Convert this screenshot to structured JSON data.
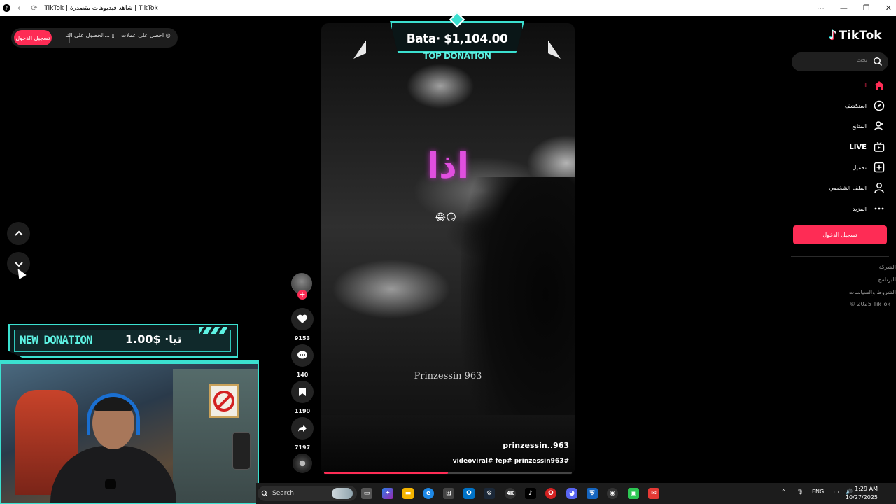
{
  "browser": {
    "title": "TikTok | شاهد فيديوهات متصدرة | TikTok",
    "minimize": "—",
    "restore": "❐",
    "close": "✕",
    "menu": "⋯"
  },
  "top_actions": {
    "login": "تسجيل الدخول",
    "get_app": "الحصول على التـ...",
    "get_coins": "احصل على عملات"
  },
  "overlay": {
    "top_donation_value": "Bata· $1,104.00",
    "top_donation_label": "TOP DONATION",
    "new_donation_label": "NEW DONATION",
    "new_donation_amount": "تيا· $1.00"
  },
  "video": {
    "text": "اذا",
    "emoji": "😂😏",
    "watermark": "Prinzessin 963",
    "author": "prinzessin..963",
    "caption": "videoviral# fep# prinzessin963#",
    "progress": 0.5
  },
  "actions": {
    "likes": "9153",
    "comments": "140",
    "saves": "1190",
    "shares": "7197"
  },
  "sidebar": {
    "logo": "TikTok",
    "search_placeholder": "بحث",
    "items": [
      {
        "label": "الـ",
        "icon": "home-icon",
        "active": true
      },
      {
        "label": "استكشف",
        "icon": "compass-icon"
      },
      {
        "label": "المتابَع",
        "icon": "following-icon"
      },
      {
        "label": "LIVE",
        "icon": "live-icon"
      },
      {
        "label": "تحميل",
        "icon": "upload-icon"
      },
      {
        "label": "الملف الشخصي",
        "icon": "profile-icon"
      },
      {
        "label": "المزيد",
        "icon": "more-icon"
      }
    ],
    "login_button": "تسجيل الدخول",
    "footer": [
      "الشركة",
      "البرنامج",
      "الشروط والسياسات",
      "© 2025 TikTok"
    ]
  },
  "taskbar": {
    "search_label": "Search",
    "lang": "ENG",
    "time": "1:29 AM",
    "date": "10/27/2025"
  },
  "colors": {
    "accent": "#fe2c55",
    "overlay_cyan": "#3be0d0",
    "video_text": "#e14fe0"
  }
}
